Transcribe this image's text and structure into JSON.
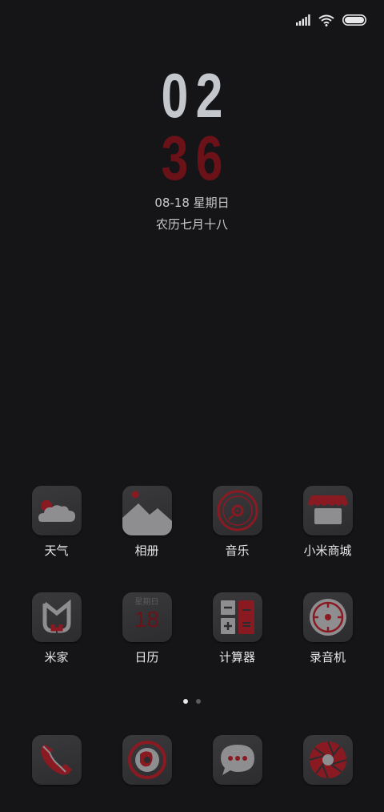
{
  "clock": {
    "hours": "02",
    "minutes": "36"
  },
  "date": {
    "line": "08-18 星期日",
    "lunar": "农历七月十八"
  },
  "apps_row1": [
    {
      "label": "天气",
      "icon": "weather-cloud-icon"
    },
    {
      "label": "相册",
      "icon": "gallery-mountain-icon"
    },
    {
      "label": "音乐",
      "icon": "music-disc-icon"
    },
    {
      "label": "小米商城",
      "icon": "store-awning-icon"
    }
  ],
  "apps_row2": [
    {
      "label": "米家",
      "icon": "mijia-logo-icon"
    },
    {
      "label": "日历",
      "icon": "calendar-icon"
    },
    {
      "label": "计算器",
      "icon": "calculator-icon"
    },
    {
      "label": "录音机",
      "icon": "recorder-icon"
    }
  ],
  "calendar_icon": {
    "weekday": "星期日",
    "day": "18"
  },
  "dock": [
    {
      "icon": "phone-icon"
    },
    {
      "icon": "browser-icon"
    },
    {
      "icon": "messages-icon"
    },
    {
      "icon": "camera-icon"
    }
  ],
  "page_indicator": {
    "total": 2,
    "active": 1
  },
  "colors": {
    "background": "#151517",
    "accent_red": "#8a1a22",
    "icon_grey": "#8c8c8f"
  }
}
